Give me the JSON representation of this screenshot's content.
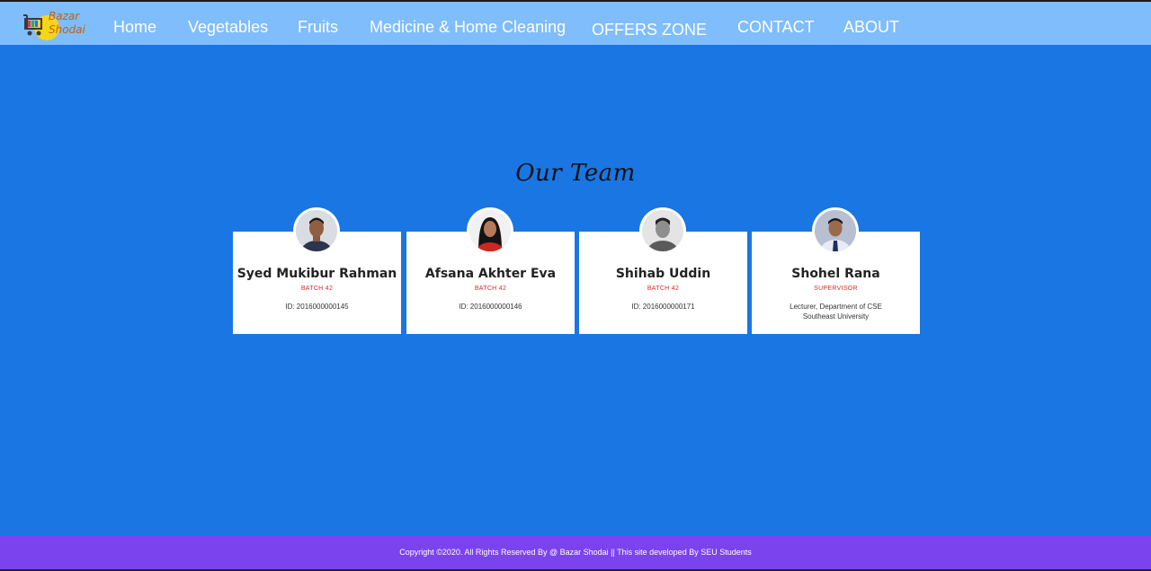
{
  "brand": {
    "line1": "Bazar",
    "line2": "Shodai"
  },
  "nav": {
    "items": [
      {
        "label": "Home"
      },
      {
        "label": "Vegetables"
      },
      {
        "label": "Fruits"
      },
      {
        "label": "Medicine & Home Cleaning"
      },
      {
        "label": "OFFERS ZONE"
      },
      {
        "label": "CONTACT"
      },
      {
        "label": "ABOUT"
      }
    ]
  },
  "main": {
    "heading": "Our Team",
    "members": [
      {
        "name": "Syed Mukibur Rahman",
        "role": "BATCH 42",
        "detail": "ID: 2016000000145",
        "detail2": ""
      },
      {
        "name": "Afsana Akhter Eva",
        "role": "BATCH 42",
        "detail": "ID: 2016000000146",
        "detail2": ""
      },
      {
        "name": "Shihab Uddin",
        "role": "BATCH 42",
        "detail": "ID: 2016000000171",
        "detail2": ""
      },
      {
        "name": "Shohel Rana",
        "role": "SUPERVISOR",
        "detail": "Lecturer, Department of CSE",
        "detail2": "Southeast University"
      }
    ]
  },
  "footer": {
    "text": "Copyright ©2020. All Rights Reserved By @ Bazar Shodai || This site developed By SEU Students"
  },
  "colors": {
    "page_bg": "#1976e3",
    "navbar_bg": "#7fbdfd",
    "footer_bg": "#7b43ee",
    "role_text": "#d42b2b"
  }
}
